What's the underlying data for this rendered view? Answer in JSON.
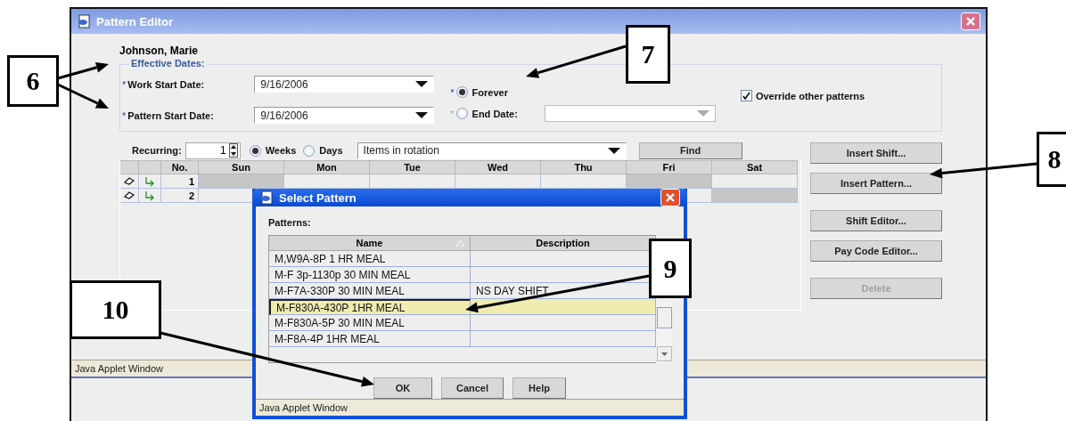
{
  "callouts": [
    {
      "label": "6"
    },
    {
      "label": "7"
    },
    {
      "label": "8"
    },
    {
      "label": "9"
    },
    {
      "label": "10"
    }
  ],
  "main_window": {
    "title": "Pattern Editor",
    "employee": "Johnson, Marie",
    "effective_dates": {
      "legend": "Effective Dates:",
      "fields": [
        {
          "mark": "*",
          "label": "Work Start Date:",
          "value": "9/16/2006"
        },
        {
          "mark": "*",
          "label": "Pattern Start Date:",
          "value": "9/16/2006"
        }
      ],
      "end_options": [
        {
          "mark": "*",
          "label": "Forever",
          "selected": true
        },
        {
          "mark": "*",
          "label": "End Date:",
          "selected": false
        }
      ],
      "end_date_field": {
        "disabled": true
      },
      "override": {
        "label": "Override other patterns",
        "checked": true
      }
    },
    "recurring": {
      "label": "Recurring:",
      "value": "1"
    },
    "period_options": [
      {
        "label": "Weeks",
        "selected": true
      },
      {
        "label": "Days",
        "selected": false
      }
    ],
    "rotation_field": {
      "value": "Items in rotation"
    },
    "find_button": "Find",
    "table": {
      "columns": [
        "No.",
        "Sun",
        "Mon",
        "Tue",
        "Wed",
        "Thu",
        "Fri",
        "Sat"
      ],
      "rows": [
        {
          "no": "1",
          "shaded": [
            true,
            false,
            false,
            false,
            false,
            true,
            false
          ]
        },
        {
          "no": "2",
          "shaded": [
            false,
            false,
            false,
            false,
            false,
            false,
            true
          ]
        }
      ]
    },
    "buttons": [
      {
        "label": "Insert Shift...",
        "disabled": false
      },
      {
        "label": "Insert Pattern...",
        "disabled": false
      },
      {
        "label": "Shift Editor...",
        "disabled": false
      },
      {
        "label": "Pay Code Editor...",
        "disabled": false
      },
      {
        "label": "Delete",
        "disabled": true
      }
    ],
    "status": "Java Applet Window"
  },
  "dialog": {
    "title": "Select Pattern",
    "list_label": "Patterns:",
    "columns": [
      {
        "label": "Name",
        "sorted": true
      },
      {
        "label": "Description",
        "sorted": false
      }
    ],
    "rows": [
      {
        "name": "M,W9A-8P 1 HR MEAL",
        "selected": false
      },
      {
        "name": "M-F 3p-1130p 30 MIN MEAL",
        "selected": false
      },
      {
        "name": "M-F7A-330P 30 MIN MEAL",
        "description": "NS DAY SHIFT",
        "selected": false
      },
      {
        "name": "M-F830A-430P 1HR MEAL",
        "selected": true
      },
      {
        "name": "M-F830A-5P 30 MIN MEAL",
        "selected": false
      },
      {
        "name": "M-F8A-4P 1HR MEAL",
        "selected": false
      }
    ],
    "buttons": [
      "OK",
      "Cancel",
      "Help"
    ],
    "status": "Java Applet Window"
  }
}
